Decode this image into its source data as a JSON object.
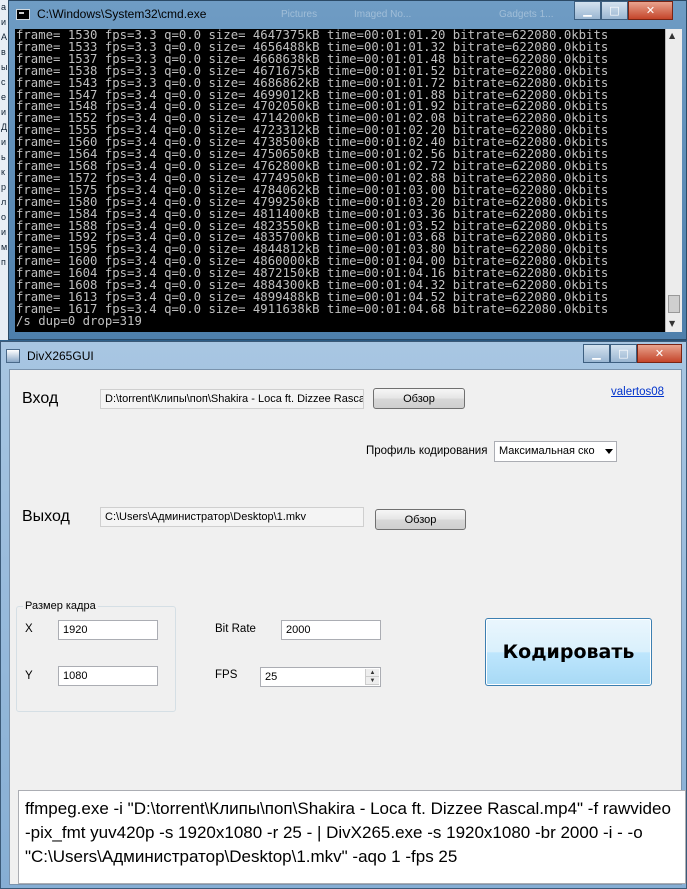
{
  "desktop_edge": [
    "а",
    "и",
    "А",
    "в",
    "ы",
    "с",
    "е",
    "и",
    "Д",
    "и",
    "ь",
    "к",
    "р",
    "л",
    "о",
    "и",
    "м",
    "п"
  ],
  "cmd": {
    "title": "C:\\Windows\\System32\\cmd.exe",
    "ghost_tabs": [
      "Pictures",
      "Imaged No...",
      "Gadgets 1..."
    ],
    "lines": [
      "frame= 1530 fps=3.3 q=0.0 size= 4647375kB time=00:01:01.20 bitrate=622080.0kbits",
      "frame= 1533 fps=3.3 q=0.0 size= 4656488kB time=00:01:01.32 bitrate=622080.0kbits",
      "frame= 1537 fps=3.3 q=0.0 size= 4668638kB time=00:01:01.48 bitrate=622080.0kbits",
      "frame= 1538 fps=3.3 q=0.0 size= 4671675kB time=00:01:01.52 bitrate=622080.0kbits",
      "frame= 1543 fps=3.3 q=0.0 size= 4686862kB time=00:01:01.72 bitrate=622080.0kbits",
      "frame= 1547 fps=3.4 q=0.0 size= 4699012kB time=00:01:01.88 bitrate=622080.0kbits",
      "frame= 1548 fps=3.4 q=0.0 size= 4702050kB time=00:01:01.92 bitrate=622080.0kbits",
      "frame= 1552 fps=3.4 q=0.0 size= 4714200kB time=00:01:02.08 bitrate=622080.0kbits",
      "frame= 1555 fps=3.4 q=0.0 size= 4723312kB time=00:01:02.20 bitrate=622080.0kbits",
      "frame= 1560 fps=3.4 q=0.0 size= 4738500kB time=00:01:02.40 bitrate=622080.0kbits",
      "frame= 1564 fps=3.4 q=0.0 size= 4750650kB time=00:01:02.56 bitrate=622080.0kbits",
      "frame= 1568 fps=3.4 q=0.0 size= 4762800kB time=00:01:02.72 bitrate=622080.0kbits",
      "frame= 1572 fps=3.4 q=0.0 size= 4774950kB time=00:01:02.88 bitrate=622080.0kbits",
      "frame= 1575 fps=3.4 q=0.0 size= 4784062kB time=00:01:03.00 bitrate=622080.0kbits",
      "frame= 1580 fps=3.4 q=0.0 size= 4799250kB time=00:01:03.20 bitrate=622080.0kbits",
      "frame= 1584 fps=3.4 q=0.0 size= 4811400kB time=00:01:03.36 bitrate=622080.0kbits",
      "frame= 1588 fps=3.4 q=0.0 size= 4823550kB time=00:01:03.52 bitrate=622080.0kbits",
      "frame= 1592 fps=3.4 q=0.0 size= 4835700kB time=00:01:03.68 bitrate=622080.0kbits",
      "frame= 1595 fps=3.4 q=0.0 size= 4844812kB time=00:01:03.80 bitrate=622080.0kbits",
      "frame= 1600 fps=3.4 q=0.0 size= 4860000kB time=00:01:04.00 bitrate=622080.0kbits",
      "frame= 1604 fps=3.4 q=0.0 size= 4872150kB time=00:01:04.16 bitrate=622080.0kbits",
      "frame= 1608 fps=3.4 q=0.0 size= 4884300kB time=00:01:04.32 bitrate=622080.0kbits",
      "frame= 1613 fps=3.4 q=0.0 size= 4899488kB time=00:01:04.52 bitrate=622080.0kbits",
      "frame= 1617 fps=3.4 q=0.0 size= 4911638kB time=00:01:04.68 bitrate=622080.0kbits",
      "/s dup=0 drop=319"
    ]
  },
  "gui": {
    "title": "DivX265GUI",
    "input_label": "Вход",
    "input_path": "D:\\torrent\\Клипы\\поп\\Shakira - Loca ft. Dizzee Rasca",
    "browse_label": "Обзор",
    "author_link": "valertos08",
    "profile_label": "Профиль кодирования",
    "profile_value": "Максимальная ско",
    "output_label": "Выход",
    "output_path": "C:\\Users\\Администратор\\Desktop\\1.mkv",
    "frame_group_title": "Размер кадра",
    "x_label": "X",
    "x_value": "1920",
    "y_label": "Y",
    "y_value": "1080",
    "bitrate_label": "Bit Rate",
    "bitrate_value": "2000",
    "fps_label": "FPS",
    "fps_value": "25",
    "encode_label": "Кодировать",
    "command_line": "ffmpeg.exe -i \"D:\\torrent\\Клипы\\поп\\Shakira - Loca ft. Dizzee Rascal.mp4\" -f rawvideo -pix_fmt yuv420p -s 1920x1080 -r 25 - | DivX265.exe -s 1920x1080 -br 2000 -i - -o \"C:\\Users\\Администратор\\Desktop\\1.mkv\" -aqo 1 -fps 25"
  },
  "colors": {
    "console_bg": "#000000",
    "console_text": "#c0c0c0",
    "link": "#0033cc",
    "close_button": "#c4452a"
  }
}
